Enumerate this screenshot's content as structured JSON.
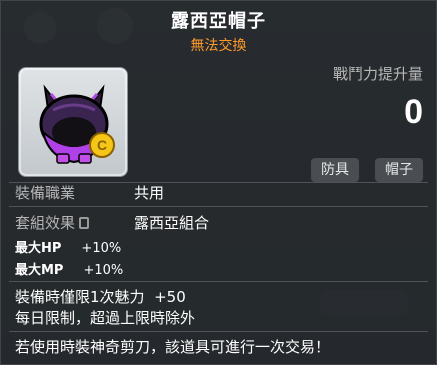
{
  "item": {
    "name": "露西亞帽子",
    "trade_status": "無法交換",
    "combat_label": "戰鬥力提升量",
    "combat_value": "0",
    "tags": [
      "防具",
      "帽子"
    ]
  },
  "job": {
    "label": "裝備職業",
    "value": "共用"
  },
  "set": {
    "label": "套組效果",
    "value": "露西亞組合",
    "lock_icon": "lock-icon"
  },
  "set_bonuses": [
    {
      "label": "最大HP",
      "value": "+10%"
    },
    {
      "label": "最大MP",
      "value": "+10%"
    }
  ],
  "limit": {
    "line1": "裝備時僅限1次魅力",
    "line1_value": "+50",
    "line2": "每日限制，超過上限時除外"
  },
  "note": "若使用時裝神奇剪刀，該道具可進行一次交易！",
  "colors": {
    "trade_status": "#ff9a2a",
    "accent_item": "#8a2fc9"
  }
}
